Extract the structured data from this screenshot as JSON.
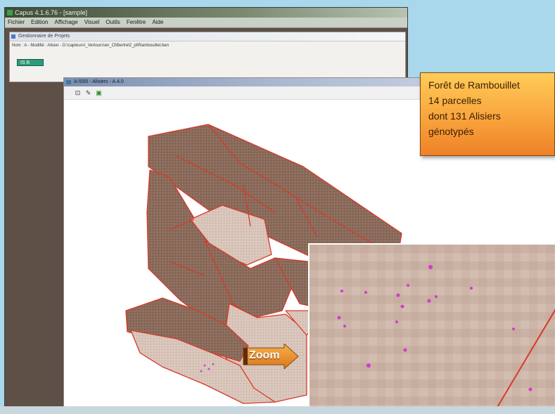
{
  "app": {
    "title": "Capus 4.1.6.76 - [sample]",
    "menu": [
      "Fichier",
      "Edition",
      "Affichage",
      "Visuel",
      "Outils",
      "Fenêtre",
      "Aide"
    ]
  },
  "subwindow": {
    "title": "Gestionnaire de Projets",
    "path": "Nom : A - Modifié : Alisier - D:\\capteurs\\_Vertours\\en_Cl\\Bertrel2_pl\\Rambouillet.ben",
    "id_value": "IS   B"
  },
  "mapwindow": {
    "title": "A:\\000 - Alisiers - A.4.0",
    "tools": [
      "zoom-tool",
      "pan-tool",
      "layers-tool"
    ]
  },
  "info": {
    "line1": "Forêt de Rambouillet",
    "line2": "14 parcelles",
    "line3": "dont 131 Alisiers",
    "line4": "génotypés"
  },
  "zoom_label": "Zoom",
  "colors": {
    "parcel_dark": "#8a6a5a",
    "parcel_light": "#d8c3b8",
    "parcel_border": "#d83a2a",
    "tree_points": "#d23bd0",
    "info_bg": "#f8a43c"
  }
}
